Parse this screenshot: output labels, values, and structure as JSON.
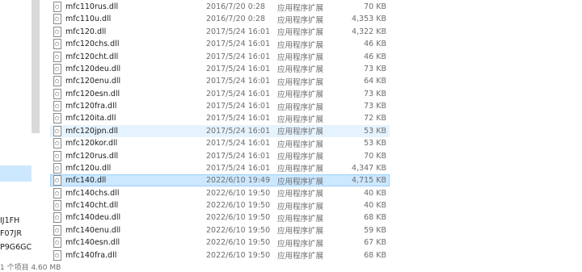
{
  "nav": {
    "items": [
      "IJ1FH",
      "F07JR",
      "P9G6GC"
    ],
    "status": "1 个项目 4.60 MB"
  },
  "files": [
    {
      "name": "mfc110rus.dll",
      "date": "2016/7/20 0:28",
      "type": "应用程序扩展",
      "size": "70 KB"
    },
    {
      "name": "mfc110u.dll",
      "date": "2016/7/20 0:28",
      "type": "应用程序扩展",
      "size": "4,353 KB"
    },
    {
      "name": "mfc120.dll",
      "date": "2017/5/24 16:01",
      "type": "应用程序扩展",
      "size": "4,322 KB"
    },
    {
      "name": "mfc120chs.dll",
      "date": "2017/5/24 16:01",
      "type": "应用程序扩展",
      "size": "46 KB"
    },
    {
      "name": "mfc120cht.dll",
      "date": "2017/5/24 16:01",
      "type": "应用程序扩展",
      "size": "46 KB"
    },
    {
      "name": "mfc120deu.dll",
      "date": "2017/5/24 16:01",
      "type": "应用程序扩展",
      "size": "73 KB"
    },
    {
      "name": "mfc120enu.dll",
      "date": "2017/5/24 16:01",
      "type": "应用程序扩展",
      "size": "64 KB"
    },
    {
      "name": "mfc120esn.dll",
      "date": "2017/5/24 16:01",
      "type": "应用程序扩展",
      "size": "73 KB"
    },
    {
      "name": "mfc120fra.dll",
      "date": "2017/5/24 16:01",
      "type": "应用程序扩展",
      "size": "73 KB"
    },
    {
      "name": "mfc120ita.dll",
      "date": "2017/5/24 16:01",
      "type": "应用程序扩展",
      "size": "72 KB"
    },
    {
      "name": "mfc120jpn.dll",
      "date": "2017/5/24 16:01",
      "type": "应用程序扩展",
      "size": "53 KB"
    },
    {
      "name": "mfc120kor.dll",
      "date": "2017/5/24 16:01",
      "type": "应用程序扩展",
      "size": "53 KB"
    },
    {
      "name": "mfc120rus.dll",
      "date": "2017/5/24 16:01",
      "type": "应用程序扩展",
      "size": "70 KB"
    },
    {
      "name": "mfc120u.dll",
      "date": "2017/5/24 16:01",
      "type": "应用程序扩展",
      "size": "4,347 KB"
    },
    {
      "name": "mfc140.dll",
      "date": "2022/6/10 19:49",
      "type": "应用程序扩展",
      "size": "4,715 KB"
    },
    {
      "name": "mfc140chs.dll",
      "date": "2022/6/10 19:50",
      "type": "应用程序扩展",
      "size": "40 KB"
    },
    {
      "name": "mfc140cht.dll",
      "date": "2022/6/10 19:50",
      "type": "应用程序扩展",
      "size": "40 KB"
    },
    {
      "name": "mfc140deu.dll",
      "date": "2022/6/10 19:50",
      "type": "应用程序扩展",
      "size": "68 KB"
    },
    {
      "name": "mfc140enu.dll",
      "date": "2022/6/10 19:50",
      "type": "应用程序扩展",
      "size": "59 KB"
    },
    {
      "name": "mfc140esn.dll",
      "date": "2022/6/10 19:50",
      "type": "应用程序扩展",
      "size": "67 KB"
    },
    {
      "name": "mfc140fra.dll",
      "date": "2022/6/10 19:50",
      "type": "应用程序扩展",
      "size": "68 KB"
    }
  ],
  "state": {
    "hover_row": "mfc120jpn.dll",
    "selected_row": "mfc140.dll"
  },
  "colors": {
    "selected": "#cce8ff",
    "hover": "#e5f3ff",
    "muted_text": "#6d6d6d"
  },
  "icons": {
    "file": "dll-file-icon"
  }
}
